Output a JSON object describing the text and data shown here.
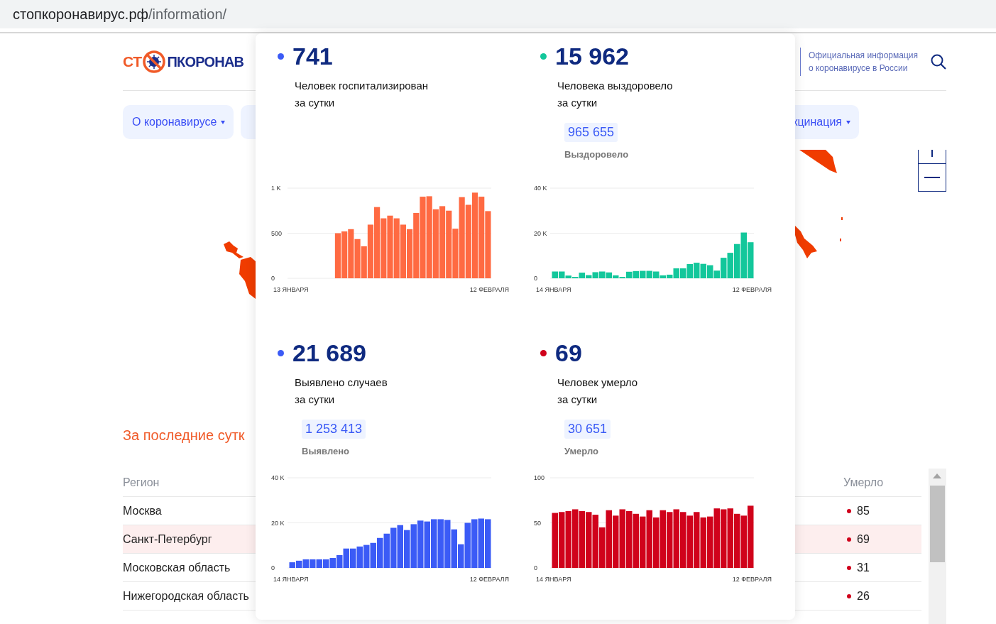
{
  "address_bar": {
    "host": "стопкоронавирус.рф",
    "path": "/information/"
  },
  "header": {
    "logo": {
      "left": "СТ",
      "right": "ПКОРОНАВ"
    },
    "tagline_lines": [
      "Официальная информация",
      "о коронавирусе в России"
    ]
  },
  "nav": [
    {
      "label": "О коронавирусе",
      "caret": true
    },
    {
      "label": "кцинация",
      "caret": true
    }
  ],
  "section_title": "За последние сутк",
  "table": {
    "columns": [
      "Регион",
      "Умерло"
    ],
    "rows": [
      {
        "region": "Москва",
        "deaths": "85",
        "selected": false
      },
      {
        "region": "Санкт-Петербург",
        "deaths": "69",
        "selected": true
      },
      {
        "region": "Московская область",
        "deaths": "31",
        "selected": false
      },
      {
        "region": "Нижегородская область",
        "deaths": "26",
        "selected": false
      }
    ]
  },
  "popup": {
    "stats": [
      {
        "color": "#3b5bf6",
        "value": "741",
        "label_lines": [
          "Человек госпитализирован",
          "за сутки"
        ],
        "date_labels": [
          "13 ЯНВАРЯ",
          "12 ФЕВРАЛЯ"
        ],
        "chart_data": {
          "type": "bar",
          "ylim": [
            0,
            1000
          ],
          "yticks": [
            {
              "value": 0,
              "label": "0"
            },
            {
              "value": 500,
              "label": "500"
            },
            {
              "value": 1000,
              "label": "1 K"
            }
          ],
          "series": [
            {
              "color": "#ff6a42",
              "values": [
                null,
                null,
                null,
                null,
                null,
                null,
                null,
                500,
                520,
                545,
                435,
                355,
                595,
                790,
                665,
                695,
                665,
                595,
                545,
                725,
                905,
                910,
                765,
                800,
                750,
                550,
                900,
                815,
                950,
                905,
                745
              ]
            }
          ]
        }
      },
      {
        "color": "#13c79b",
        "value": "15 962",
        "label_lines": [
          "Человека выздоровело",
          "за сутки"
        ],
        "total": "965 655",
        "total_label": "Выздоровело",
        "date_labels": [
          "14 ЯНВАРЯ",
          "12 ФЕВРАЛЯ"
        ],
        "chart_data": {
          "type": "bar",
          "ylim": [
            0,
            40000
          ],
          "yticks": [
            {
              "value": 0,
              "label": "0"
            },
            {
              "value": 20000,
              "label": "20 K"
            },
            {
              "value": 40000,
              "label": "40 K"
            }
          ],
          "series": [
            {
              "color": "#13c79b",
              "values": [
                3000,
                3000,
                1200,
                600,
                2500,
                1400,
                2700,
                3000,
                2600,
                1300,
                600,
                2900,
                3200,
                3300,
                3300,
                3000,
                1300,
                1600,
                4400,
                4400,
                6300,
                6900,
                6400,
                5800,
                3400,
                9100,
                11300,
                15200,
                20300,
                16000
              ]
            }
          ]
        }
      },
      {
        "color": "#3b5bf6",
        "value": "21 689",
        "label_lines": [
          "Выявлено случаев",
          "за сутки"
        ],
        "total": "1 253 413",
        "total_label": "Выявлено",
        "date_labels": [
          "14 ЯНВАРЯ",
          "12 ФЕВРАЛЯ"
        ],
        "chart_data": {
          "type": "bar",
          "ylim": [
            0,
            40000
          ],
          "yticks": [
            {
              "value": 0,
              "label": "0"
            },
            {
              "value": 20000,
              "label": "20 K"
            },
            {
              "value": 40000,
              "label": "40 K"
            }
          ],
          "series": [
            {
              "color": "#3b5bf6",
              "values": [
                2500,
                3200,
                3800,
                3800,
                3800,
                3800,
                4400,
                5700,
                8600,
                8600,
                9500,
                10200,
                11100,
                13300,
                15200,
                17800,
                19000,
                16800,
                19400,
                21000,
                20600,
                21600,
                21600,
                21300,
                17100,
                10500,
                20000,
                21600,
                21900,
                21600
              ]
            }
          ]
        }
      },
      {
        "color": "#d0021b",
        "value": "69",
        "label_lines": [
          "Человек умерло",
          "за сутки"
        ],
        "total": "30 651",
        "total_label": "Умерло",
        "date_labels": [
          "14 ЯНВАРЯ",
          "12 ФЕВРАЛЯ"
        ],
        "chart_data": {
          "type": "bar",
          "ylim": [
            0,
            100
          ],
          "yticks": [
            {
              "value": 0,
              "label": "0"
            },
            {
              "value": 50,
              "label": "50"
            },
            {
              "value": 100,
              "label": "100"
            }
          ],
          "series": [
            {
              "color": "#d0021b",
              "values": [
                61,
                62,
                63,
                65,
                63,
                62,
                59,
                45,
                64,
                58,
                65,
                63,
                60,
                57,
                64,
                56,
                64,
                62,
                65,
                62,
                58,
                62,
                56,
                57,
                66,
                65,
                66,
                60,
                58,
                69
              ]
            }
          ]
        }
      }
    ]
  }
}
